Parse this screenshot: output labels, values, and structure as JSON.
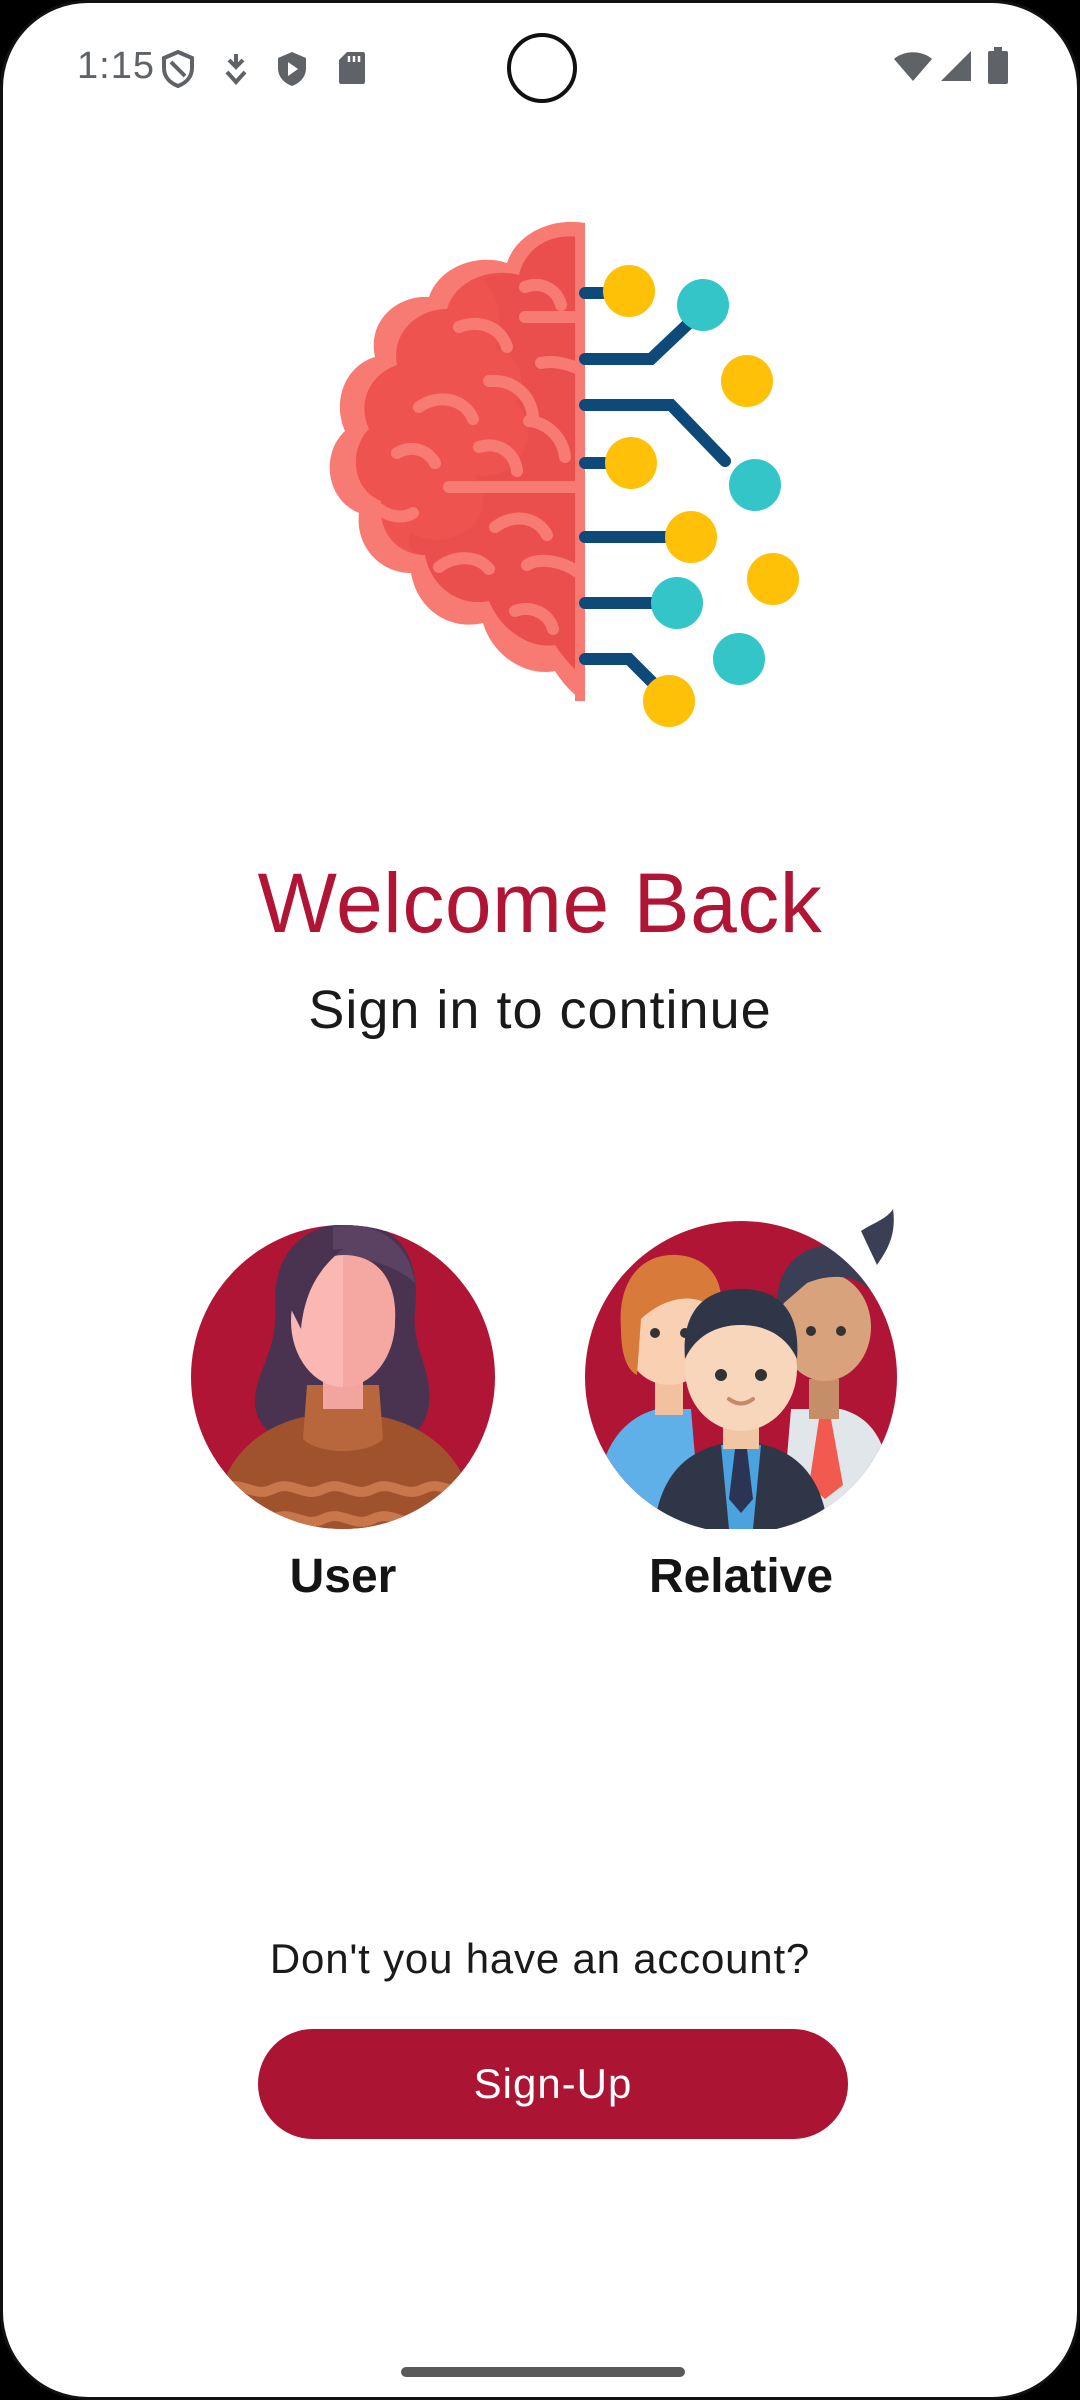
{
  "status_bar": {
    "time": "1:15",
    "icons": [
      "shield-outline-icon",
      "download-arrow-icon",
      "play-shield-icon",
      "sd-card-icon",
      "wifi-icon",
      "cellular-signal-icon",
      "battery-icon"
    ]
  },
  "welcome": {
    "title": "Welcome Back",
    "subtitle": "Sign in to continue"
  },
  "roles": {
    "user_label": "User",
    "relative_label": "Relative"
  },
  "signup": {
    "prompt": "Don't you have an account?",
    "button_label": "Sign-Up"
  },
  "colors": {
    "brand": "#ac1434",
    "title": "#b11535",
    "brain_red": "#ef5350",
    "circuit_navy": "#0d4a79",
    "node_yellow": "#ffc107",
    "node_teal": "#33c5c8"
  }
}
